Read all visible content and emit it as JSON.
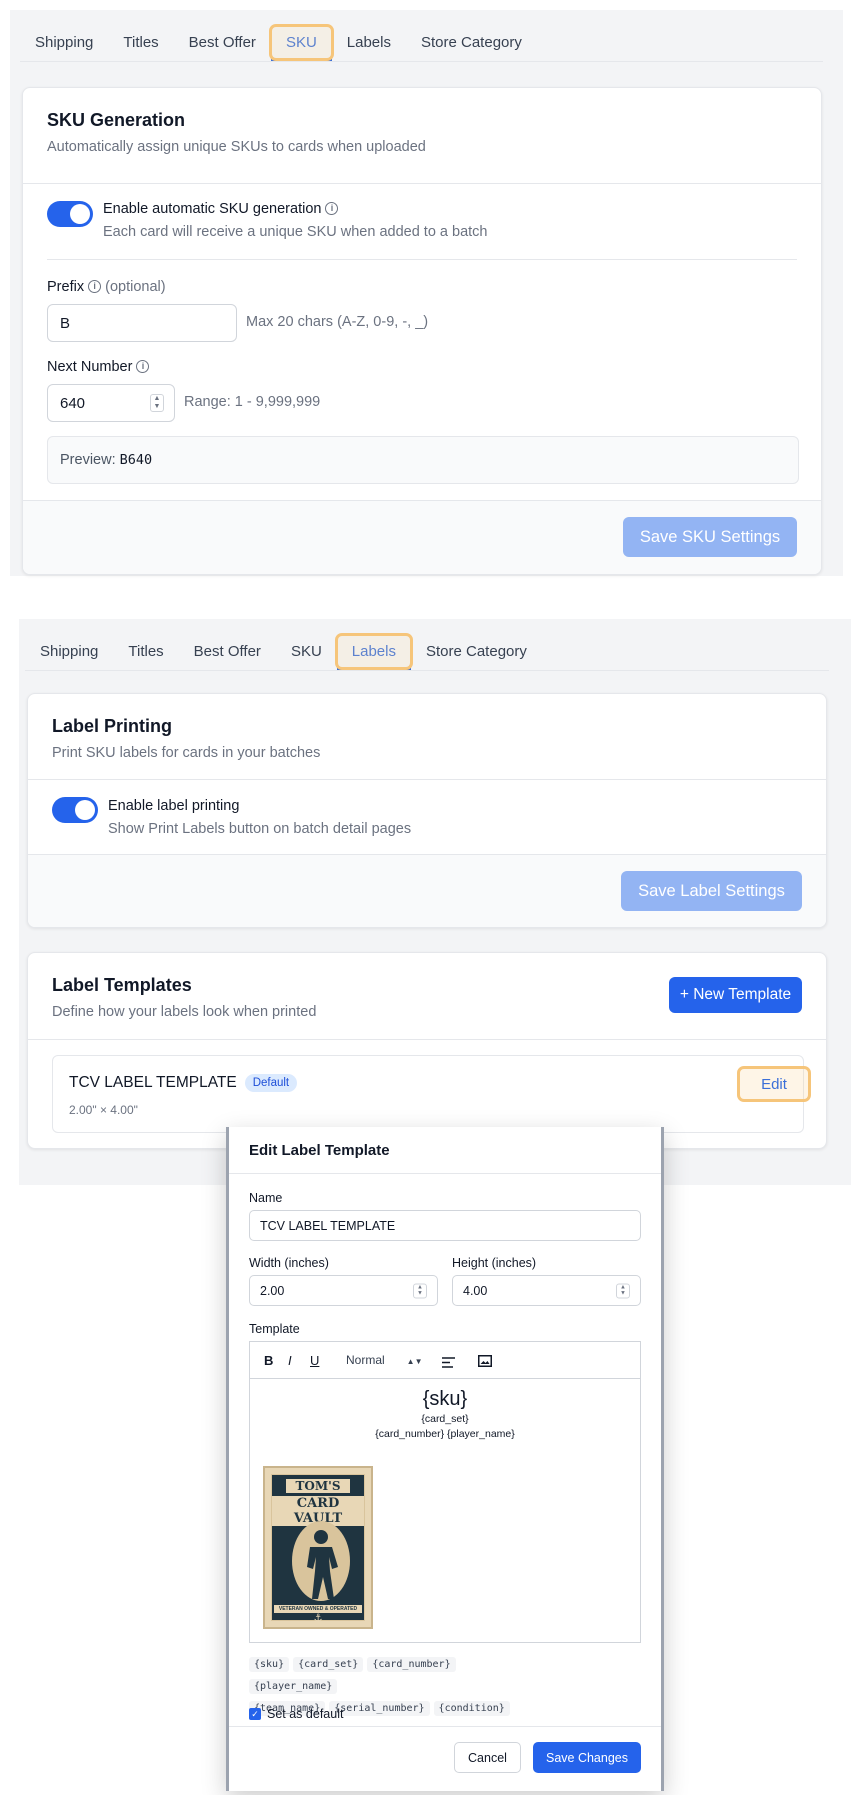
{
  "panel1": {
    "tabs": [
      "Shipping",
      "Titles",
      "Best Offer",
      "SKU",
      "Labels",
      "Store Category"
    ],
    "active_tab": "SKU",
    "card": {
      "title": "SKU Generation",
      "subtitle": "Automatically assign unique SKUs to cards when uploaded",
      "toggle_label": "Enable automatic SKU generation",
      "toggle_help": "Each card will receive a unique SKU when added to a batch",
      "prefix_label": "Prefix",
      "prefix_optional": "(optional)",
      "prefix_value": "B",
      "prefix_hint": "Max 20 chars (A-Z, 0-9, -, _)",
      "next_label": "Next Number",
      "next_value": "640",
      "next_hint": "Range: 1 - 9,999,999",
      "preview_label": "Preview:",
      "preview_value": "B640",
      "save_button": "Save SKU Settings"
    }
  },
  "panel2": {
    "tabs": [
      "Shipping",
      "Titles",
      "Best Offer",
      "SKU",
      "Labels",
      "Store Category"
    ],
    "active_tab": "Labels",
    "printing": {
      "title": "Label Printing",
      "subtitle": "Print SKU labels for cards in your batches",
      "toggle_label": "Enable label printing",
      "toggle_help": "Show Print Labels button on batch detail pages",
      "save_button": "Save Label Settings"
    },
    "templates": {
      "title": "Label Templates",
      "subtitle": "Define how your labels look when printed",
      "new_button": "+ New Template",
      "item_name": "TCV LABEL TEMPLATE",
      "item_badge": "Default",
      "item_size": "2.00\" × 4.00\"",
      "edit_button": "Edit"
    }
  },
  "modal": {
    "title": "Edit Label Template",
    "name_label": "Name",
    "name_value": "TCV LABEL TEMPLATE",
    "width_label": "Width (inches)",
    "width_value": "2.00",
    "height_label": "Height (inches)",
    "height_value": "4.00",
    "template_label": "Template",
    "toolbar": {
      "bold": "B",
      "italic": "I",
      "underline": "U",
      "format": "Normal"
    },
    "editor": {
      "line1": "{sku}",
      "line2": "{card_set}",
      "line3": "{card_number} {player_name}",
      "logo": {
        "line1": "TOM'S",
        "line2": "CARD VAULT",
        "line3": "VETERAN OWNED & OPERATED"
      }
    },
    "placeholders": [
      "{sku}",
      "{card_set}",
      "{card_number}",
      "{player_name}",
      "{team_name}",
      "{serial_number}",
      "{condition}"
    ],
    "default_label": "Set as default",
    "cancel_button": "Cancel",
    "save_button": "Save Changes"
  }
}
